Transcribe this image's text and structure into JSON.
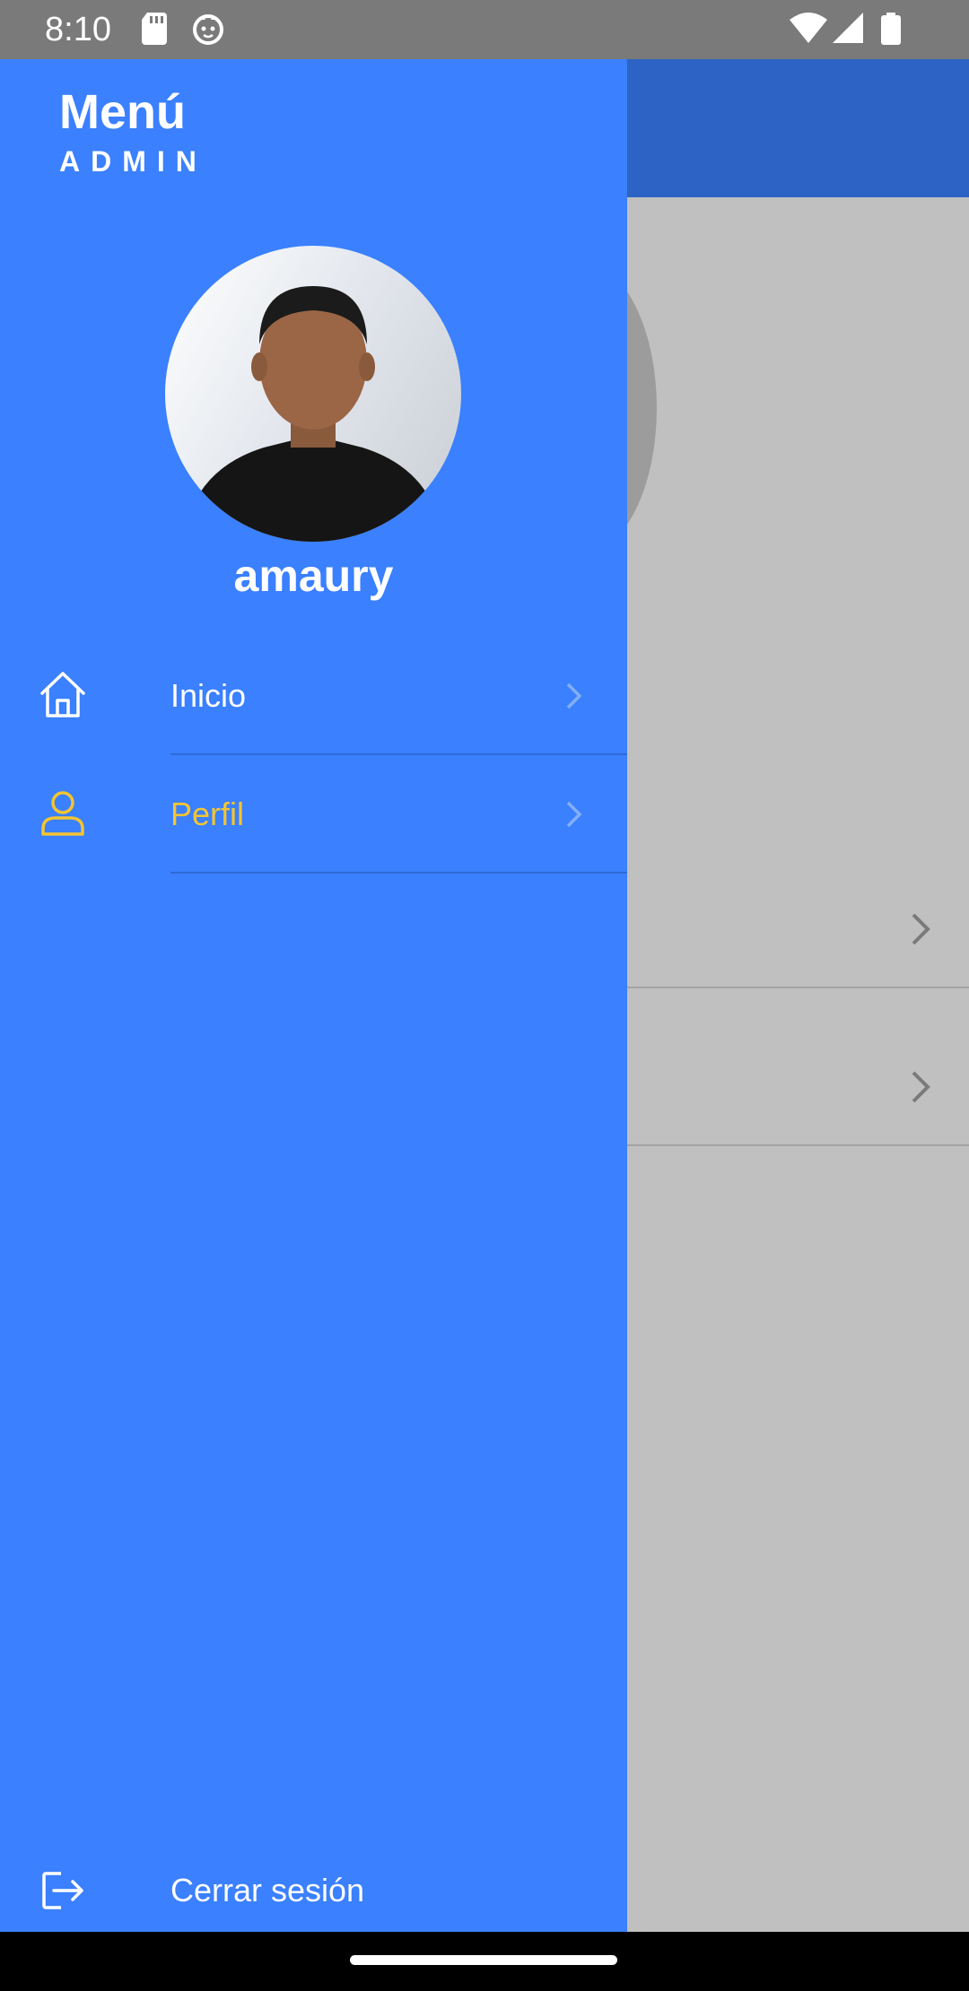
{
  "status_bar": {
    "time": "8:10",
    "icons": [
      "sd-card-icon",
      "cat-notification-icon",
      "wifi-icon",
      "signal-icon",
      "battery-icon"
    ]
  },
  "drawer": {
    "title": "Menú",
    "subtitle": "ADMIN",
    "username": "amaury",
    "background_color": "#3a80ff",
    "items": [
      {
        "label": "Inicio",
        "icon": "home-icon",
        "active": false
      },
      {
        "label": "Perfil",
        "icon": "user-icon",
        "active": true
      }
    ],
    "logout_label": "Cerrar sesión",
    "active_color": "#f4c430"
  },
  "background_app": {
    "appbar_color": "#2d63c4",
    "scrim_color": "#c0c0c0"
  }
}
